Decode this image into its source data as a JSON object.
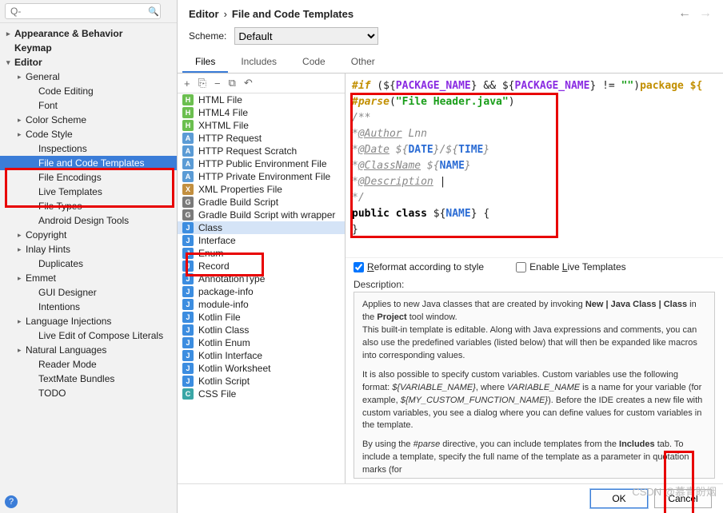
{
  "search": {
    "placeholder": "Q-"
  },
  "sidebar": [
    {
      "l": 0,
      "c": ">",
      "t": "Appearance & Behavior"
    },
    {
      "l": 0,
      "c": "",
      "t": "Keymap"
    },
    {
      "l": 0,
      "c": "v",
      "t": "Editor"
    },
    {
      "l": 1,
      "c": ">",
      "t": "General"
    },
    {
      "l": 2,
      "c": "",
      "t": "Code Editing"
    },
    {
      "l": 2,
      "c": "",
      "t": "Font"
    },
    {
      "l": 1,
      "c": ">",
      "t": "Color Scheme"
    },
    {
      "l": 1,
      "c": ">",
      "t": "Code Style"
    },
    {
      "l": 2,
      "c": "",
      "t": "Inspections"
    },
    {
      "l": 2,
      "c": "",
      "t": "File and Code Templates",
      "sel": true
    },
    {
      "l": 2,
      "c": "",
      "t": "File Encodings"
    },
    {
      "l": 2,
      "c": "",
      "t": "Live Templates"
    },
    {
      "l": 2,
      "c": "",
      "t": "File Types"
    },
    {
      "l": 2,
      "c": "",
      "t": "Android Design Tools"
    },
    {
      "l": 1,
      "c": ">",
      "t": "Copyright"
    },
    {
      "l": 1,
      "c": ">",
      "t": "Inlay Hints"
    },
    {
      "l": 2,
      "c": "",
      "t": "Duplicates"
    },
    {
      "l": 1,
      "c": ">",
      "t": "Emmet"
    },
    {
      "l": 2,
      "c": "",
      "t": "GUI Designer"
    },
    {
      "l": 2,
      "c": "",
      "t": "Intentions"
    },
    {
      "l": 1,
      "c": ">",
      "t": "Language Injections"
    },
    {
      "l": 2,
      "c": "",
      "t": "Live Edit of Compose Literals"
    },
    {
      "l": 1,
      "c": ">",
      "t": "Natural Languages"
    },
    {
      "l": 2,
      "c": "",
      "t": "Reader Mode"
    },
    {
      "l": 2,
      "c": "",
      "t": "TextMate Bundles"
    },
    {
      "l": 2,
      "c": "",
      "t": "TODO"
    }
  ],
  "breadcrumb": {
    "parent": "Editor",
    "sep": "›",
    "current": "File and Code Templates"
  },
  "scheme": {
    "label": "Scheme:",
    "value": "Default"
  },
  "tabs": [
    "Files",
    "Includes",
    "Code",
    "Other"
  ],
  "toolbar": {
    "add": "+",
    "copy": "⎘",
    "remove": "−",
    "dup": "⧉",
    "undo": "↶"
  },
  "files": [
    {
      "ic": "h",
      "t": "HTML File"
    },
    {
      "ic": "h",
      "t": "HTML4 File"
    },
    {
      "ic": "h",
      "t": "XHTML File"
    },
    {
      "ic": "api",
      "t": "HTTP Request"
    },
    {
      "ic": "api",
      "t": "HTTP Request Scratch"
    },
    {
      "ic": "api",
      "t": "HTTP Public Environment File"
    },
    {
      "ic": "api",
      "t": "HTTP Private Environment File"
    },
    {
      "ic": "x",
      "t": "XML Properties File"
    },
    {
      "ic": "g",
      "t": "Gradle Build Script"
    },
    {
      "ic": "g",
      "t": "Gradle Build Script with wrapper"
    },
    {
      "ic": "j",
      "t": "Class",
      "sel": true
    },
    {
      "ic": "j",
      "t": "Interface"
    },
    {
      "ic": "j",
      "t": "Enum"
    },
    {
      "ic": "j",
      "t": "Record"
    },
    {
      "ic": "j",
      "t": "AnnotationType"
    },
    {
      "ic": "j",
      "t": "package-info"
    },
    {
      "ic": "j",
      "t": "module-info"
    },
    {
      "ic": "j",
      "t": "Kotlin File"
    },
    {
      "ic": "j",
      "t": "Kotlin Class"
    },
    {
      "ic": "j",
      "t": "Kotlin Enum"
    },
    {
      "ic": "j",
      "t": "Kotlin Interface"
    },
    {
      "ic": "j",
      "t": "Kotlin Worksheet"
    },
    {
      "ic": "j",
      "t": "Kotlin Script"
    },
    {
      "ic": "css",
      "t": "CSS File"
    }
  ],
  "code": {
    "l1a": "#if",
    "l1b": " (${",
    "l1c": "PACKAGE_NAME",
    "l1d": "} && ${",
    "l1e": "PACKAGE_NAME",
    "l1f": "} != ",
    "l1g": "\"\"",
    "l1h": ")",
    "l1i": "package ${",
    "l2a": "#parse",
    "l2b": "(",
    "l2c": "\"File Header.java\"",
    "l2d": ")",
    "l3": "/**",
    "l4a": " *",
    "l4b": "@Author",
    "l4c": " Lnn",
    "l5a": " *",
    "l5b": "@Date",
    "l5c": " ${",
    "l5d": "DATE",
    "l5e": "}/${",
    "l5f": "TIME",
    "l5g": "}",
    "l6a": " *",
    "l6b": "@ClassName",
    "l6c": " ${",
    "l6d": "NAME",
    "l6e": "}",
    "l7a": " *",
    "l7b": "@Description",
    "l7c": " |",
    "l8": " */",
    "l9a": "public class ",
    "l9b": "${",
    "l9c": "NAME",
    "l9d": "} {",
    "l10": "}"
  },
  "opts": {
    "reformat": "Reformat according to style",
    "live": "Enable Live Templates",
    "ru": "R",
    "lu": "L"
  },
  "desc": {
    "label": "Description:",
    "p1a": "Applies to new Java classes that are created by invoking ",
    "p1b": "New | Java Class | Class",
    "p1c": " in the ",
    "p1d": "Project",
    "p1e": " tool window.",
    "p2": "This built-in template is editable. Along with Java expressions and comments, you can also use the predefined variables (listed below) that will then be expanded like macros into corresponding values.",
    "p3a": "It is also possible to specify custom variables. Custom variables use the following format: ",
    "p3b": "${VARIABLE_NAME}",
    "p3c": ", where ",
    "p3d": "VARIABLE_NAME",
    "p3e": " is a name for your variable (for example, ",
    "p3f": "${MY_CUSTOM_FUNCTION_NAME}",
    "p3g": "). Before the IDE creates a new file with custom variables, you see a dialog where you can define values for custom variables in the template.",
    "p4a": "By using the ",
    "p4b": "#parse",
    "p4c": " directive, you can include templates from the ",
    "p4d": "Includes",
    "p4e": " tab. To include a template, specify the full name of the template as a parameter in quotation marks (for"
  },
  "buttons": {
    "ok": "OK",
    "cancel": "Cancel"
  },
  "watermark": "CSDN @慕青盼烟"
}
